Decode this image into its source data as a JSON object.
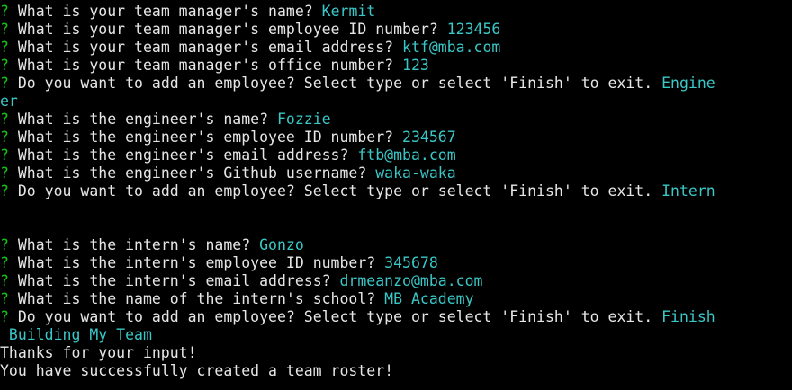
{
  "colors": {
    "background": "#000000",
    "prompt_marker": "#13c313",
    "text": "#e6e6e6",
    "answer": "#3ac7c7"
  },
  "terminal": {
    "lines": [
      {
        "mark": "?",
        "question": "What is your team manager's name?",
        "answer": "Kermit"
      },
      {
        "mark": "?",
        "question": "What is your team manager's employee ID number?",
        "answer": "123456"
      },
      {
        "mark": "?",
        "question": "What is your team manager's email address?",
        "answer": "ktf@mba.com"
      },
      {
        "mark": "?",
        "question": "What is your team manager's office number?",
        "answer": "123"
      },
      {
        "mark": "?",
        "question": "Do you want to add an employee? Select type or select 'Finish' to exit.",
        "answer": "Engine"
      },
      {
        "mark": "",
        "question": "",
        "answer": "er"
      },
      {
        "mark": "?",
        "question": "What is the engineer's name?",
        "answer": "Fozzie"
      },
      {
        "mark": "?",
        "question": "What is the engineer's employee ID number?",
        "answer": "234567"
      },
      {
        "mark": "?",
        "question": "What is the engineer's email address?",
        "answer": "ftb@mba.com"
      },
      {
        "mark": "?",
        "question": "What is the engineer's Github username?",
        "answer": "waka-waka"
      },
      {
        "mark": "?",
        "question": "Do you want to add an employee? Select type or select 'Finish' to exit.",
        "answer": "Intern"
      },
      {
        "mark": "",
        "question": "",
        "answer": ""
      },
      {
        "mark": "",
        "question": "",
        "answer": ""
      },
      {
        "mark": "?",
        "question": "What is the intern's name?",
        "answer": "Gonzo"
      },
      {
        "mark": "?",
        "question": "What is the intern's employee ID number?",
        "answer": "345678"
      },
      {
        "mark": "?",
        "question": "What is the intern's email address?",
        "answer": "drmeanzo@mba.com"
      },
      {
        "mark": "?",
        "question": "What is the name of the intern's school?",
        "answer": "MB Academy"
      },
      {
        "mark": "?",
        "question": "Do you want to add an employee? Select type or select 'Finish' to exit.",
        "answer": "Finish"
      },
      {
        "mark": "",
        "question": "",
        "answer": " Building My Team"
      },
      {
        "mark": "",
        "question": "Thanks for your input!",
        "answer": ""
      },
      {
        "mark": "",
        "question": "You have successfully created a team roster!",
        "answer": ""
      }
    ]
  }
}
